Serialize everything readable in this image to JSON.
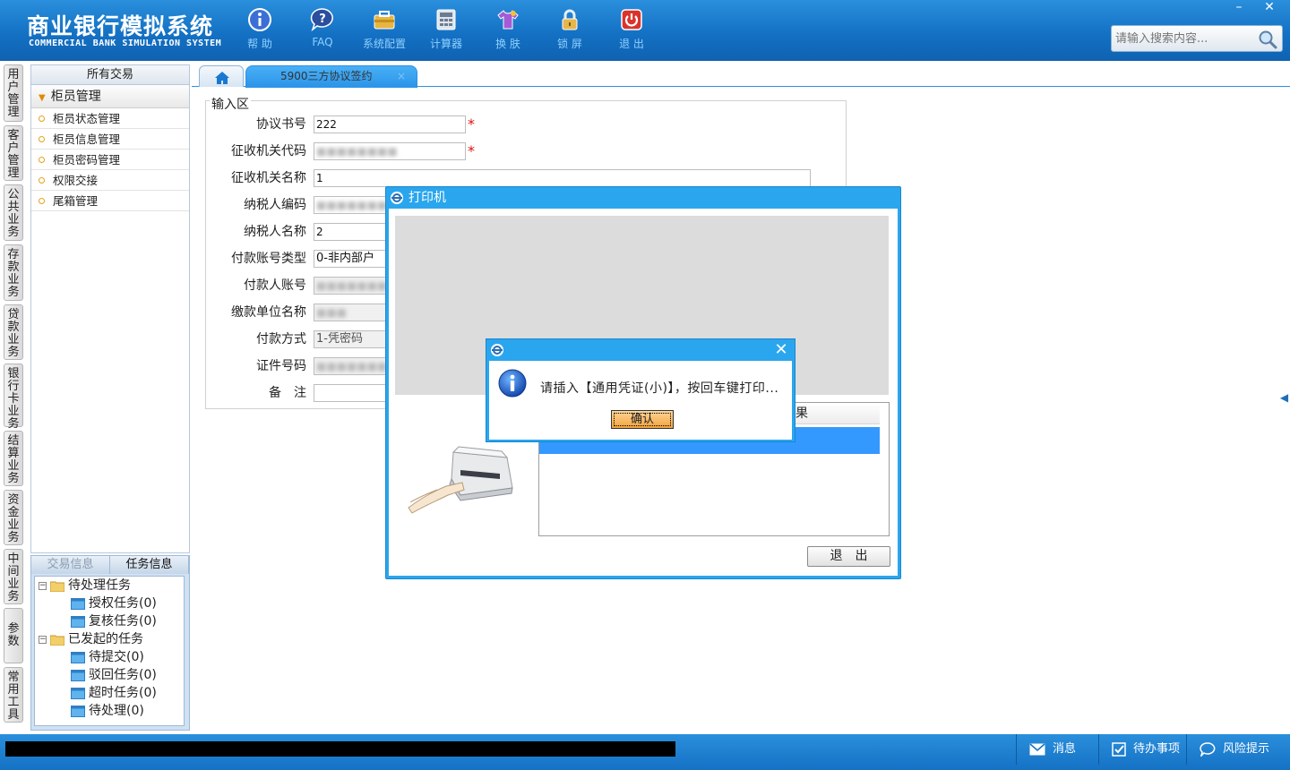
{
  "header": {
    "title": "商业银行模拟系统",
    "subtitle": "COMMERCIAL BANK SIMULATION SYSTEM",
    "toolbar": [
      {
        "label": "帮 助",
        "icon": "help-icon"
      },
      {
        "label": "FAQ",
        "icon": "faq-icon"
      },
      {
        "label": "系统配置",
        "icon": "system-config-icon"
      },
      {
        "label": "计算器",
        "icon": "calculator-icon"
      },
      {
        "label": "换 肤",
        "icon": "skin-icon"
      },
      {
        "label": "锁 屏",
        "icon": "lock-icon"
      },
      {
        "label": "退 出",
        "icon": "power-icon"
      }
    ],
    "window_controls": {
      "minimize": "–",
      "close": "✕"
    },
    "search": {
      "placeholder": "请输入搜索内容..."
    }
  },
  "vertical_tabs": [
    "用户管理",
    "客户管理",
    "公共业务",
    "存款业务",
    "贷款业务",
    "银行卡业务",
    "结算业务",
    "资金业务",
    "中间业务",
    "参数",
    "常用工具"
  ],
  "menu": {
    "title": "所有交易",
    "group": "柜员管理",
    "items": [
      "柜员状态管理",
      "柜员信息管理",
      "柜员密码管理",
      "权限交接",
      "尾箱管理"
    ]
  },
  "tasks": {
    "tab_trade_info": "交易信息",
    "tab_task_info": "任务信息",
    "tree": {
      "pending": "待处理任务",
      "authorize": "授权任务(0)",
      "review": "复核任务(0)",
      "initiated": "已发起的任务",
      "to_submit": "待提交(0)",
      "rejected": "驳回任务(0)",
      "timeout": "超时任务(0)",
      "to_process": "待处理(0)"
    }
  },
  "tabs": {
    "home_icon": "home-icon",
    "active_label": "5900三方协议签约",
    "close_symbol": "×"
  },
  "form": {
    "section_title": "输入区",
    "fields": [
      {
        "label": "协议书号",
        "value": "222",
        "required": true
      },
      {
        "label": "征收机关代码",
        "value": "",
        "required": true
      },
      {
        "label": "征收机关名称",
        "value": "1"
      },
      {
        "label": "纳税人编码",
        "value": ""
      },
      {
        "label": "纳税人名称",
        "value": "2"
      },
      {
        "label": "付款账号类型",
        "value": "0-非内部户"
      },
      {
        "label": "付款人账号",
        "value": ""
      },
      {
        "label": "缴款单位名称",
        "value": ""
      },
      {
        "label": "付款方式",
        "value": "1-凭密码"
      },
      {
        "label": "证件号码",
        "value": ""
      },
      {
        "label": "备　注",
        "value": ""
      }
    ],
    "required_mark": "*"
  },
  "printer_dialog": {
    "title": "打印机",
    "result_header": "果",
    "exit_button": "退出"
  },
  "message_box": {
    "text": "请插入【通用凭证(小)】，按回车键打印...",
    "ok_button": "确认",
    "close_symbol": "✕"
  },
  "status_bar": {
    "messages": "消息",
    "todo": "待办事项",
    "risk": "风险提示"
  },
  "colors": {
    "header_blue": "#1471c4",
    "dialog_blue": "#2aa6ee",
    "selection_blue": "#3399ff",
    "required_red": "#e01010"
  }
}
